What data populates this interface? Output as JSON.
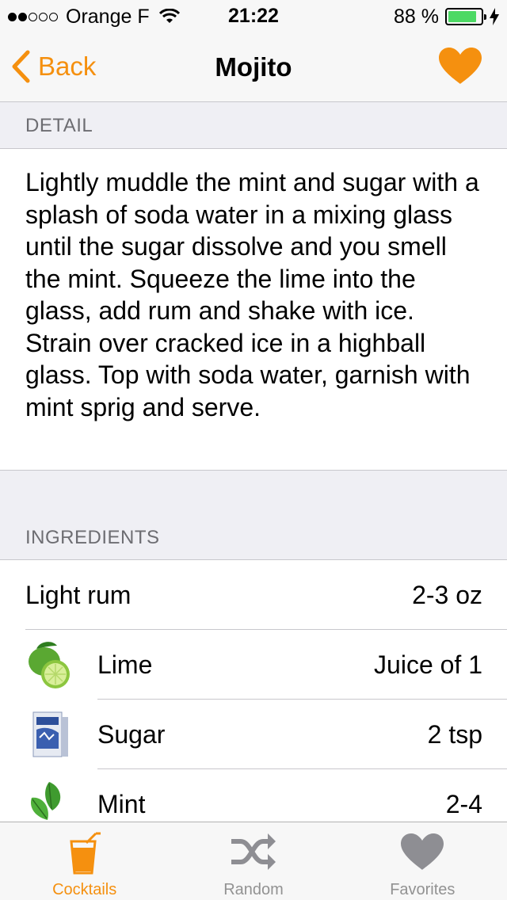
{
  "status_bar": {
    "carrier": "Orange F",
    "time": "21:22",
    "battery": "88 %",
    "battery_level": 0.88
  },
  "nav": {
    "back_label": "Back",
    "title": "Mojito",
    "favorite_icon": "heart-icon",
    "accent_color": "#f5900f"
  },
  "detail": {
    "header": "DETAIL",
    "text": "Lightly muddle the mint and sugar with a splash of soda water in a mixing glass until the sugar dissolve and you smell the mint. Squeeze the lime into the glass, add rum and shake with ice. Strain over cracked ice in a highball glass. Top with soda water, garnish with mint sprig and serve."
  },
  "ingredients": {
    "header": "INGREDIENTS",
    "items": [
      {
        "name": "Light rum",
        "quantity": "2-3 oz"
      },
      {
        "name": "Lime",
        "quantity": "Juice of 1",
        "image": "lime-image"
      },
      {
        "name": "Sugar",
        "quantity": "2 tsp",
        "image": "sugar-box-image"
      },
      {
        "name": "Mint",
        "quantity": "2-4",
        "image": "mint-leaves-image"
      }
    ]
  },
  "tabs": [
    {
      "label": "Cocktails",
      "icon": "cocktail-glass-icon",
      "active": true
    },
    {
      "label": "Random",
      "icon": "shuffle-icon",
      "active": false
    },
    {
      "label": "Favorites",
      "icon": "heart-icon",
      "active": false
    }
  ]
}
